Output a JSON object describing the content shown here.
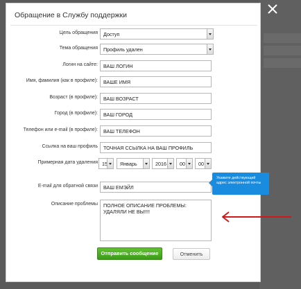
{
  "dialog": {
    "title": "Обращение в Службу поддержки"
  },
  "form": {
    "purpose": {
      "label": "Цель обращения",
      "value": "Доступ"
    },
    "topic": {
      "label": "Тема обращения",
      "value": "Профиль удален"
    },
    "login": {
      "label": "Логин на сайте:",
      "value": "ВАШ ЛОГИН"
    },
    "name": {
      "label": "Имя, фамилия (как в профиле):",
      "value": "ВАШЕ ИМЯ"
    },
    "age": {
      "label": "Возраст (в профиле):",
      "value": "ВАШ ВОЗРАСТ"
    },
    "city": {
      "label": "Город (в профиле):",
      "value": "ВАШ ГОРОД"
    },
    "phone": {
      "label": "Телефон или e-mail (в профиле):",
      "value": "ВАШ ТЕЛЕФОН"
    },
    "link": {
      "label": "Ссылка на ваш профиль",
      "value": "ТОЧНАЯ ССЫЛКА НА ВАШ ПРОФИЛЬ"
    },
    "delete_date": {
      "label": "Примерная дата удаления",
      "day": "15",
      "month": "Январь",
      "year": "2016",
      "hour": "00",
      "minute": "00"
    },
    "email": {
      "label": "E-mail для обратной связи",
      "value": "ВАШ ЕМЭЙЛ"
    },
    "description": {
      "label": "Описание проблемы",
      "value": "ПОЛНОЕ ОПИСАНИЕ ПРОБЛЕМЫ: УДАЛЯЛИ НЕ ВЫ!!!!"
    }
  },
  "tooltip": {
    "text": "Укажите действующий адрес электронной почты"
  },
  "buttons": {
    "send": "Отправить сообщение",
    "cancel": "Отменить"
  },
  "colors": {
    "send_button": "#4caf27",
    "tooltip": "#1a8ce0",
    "annotation_arrow": "#d01818"
  },
  "icons": {
    "close": "close-icon",
    "annotation": "red-arrow-icon"
  }
}
